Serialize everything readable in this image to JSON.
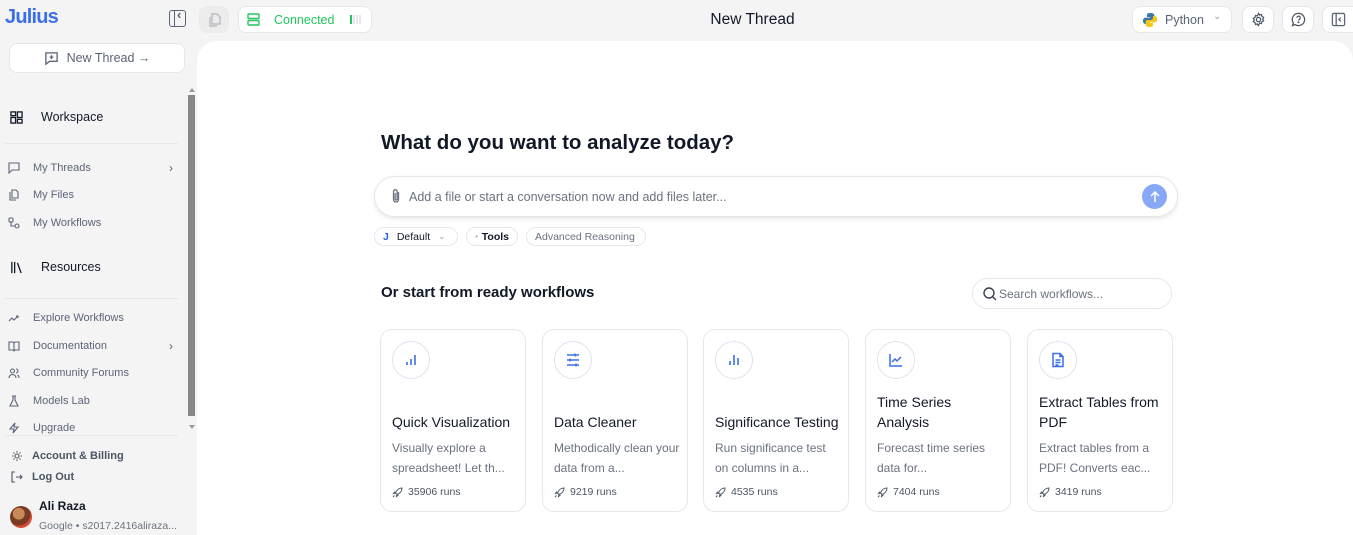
{
  "app": {
    "logo": "Julius",
    "page_title": "New Thread"
  },
  "sidebar": {
    "new_thread_label": "New Thread →",
    "workspace": {
      "heading": "Workspace",
      "items": [
        {
          "label": "My Threads",
          "icon": "chat-bubble-icon",
          "has_chevron": true
        },
        {
          "label": "My Files",
          "icon": "files-icon",
          "has_chevron": false
        },
        {
          "label": "My Workflows",
          "icon": "workflow-icon",
          "has_chevron": false
        }
      ]
    },
    "resources": {
      "heading": "Resources",
      "items": [
        {
          "label": "Explore Workflows",
          "icon": "trending-icon",
          "has_chevron": false
        },
        {
          "label": "Documentation",
          "icon": "book-icon",
          "has_chevron": true
        },
        {
          "label": "Community Forums",
          "icon": "users-icon",
          "has_chevron": false
        },
        {
          "label": "Models Lab",
          "icon": "flask-icon",
          "has_chevron": false
        },
        {
          "label": "Upgrade",
          "icon": "zap-icon",
          "has_chevron": false
        }
      ]
    },
    "account_billing": "Account & Billing",
    "log_out": "Log Out",
    "user": {
      "name": "Ali Raza",
      "sub": "Google • s2017.2416aliraza..."
    }
  },
  "topbar": {
    "connection_status": "Connected",
    "language": "Python",
    "status_color": "#22c55e"
  },
  "main": {
    "headline": "What do you want to analyze today?",
    "prompt_placeholder": "Add a file or start a conversation now and add files later...",
    "chips": {
      "model_letter": "J",
      "model": "Default",
      "tools": "Tools",
      "advanced": "Advanced Reasoning"
    },
    "workflows_heading": "Or start from ready workflows",
    "search_placeholder": "Search workflows...",
    "workflows": [
      {
        "title": "Quick Visualization",
        "desc": "Visually explore a spreadsheet! Let th...",
        "runs": "35906 runs",
        "icon": "bar-chart-icon"
      },
      {
        "title": "Data Cleaner",
        "desc": "Methodically clean your data from a...",
        "runs": "9219 runs",
        "icon": "sliders-icon"
      },
      {
        "title": "Significance Testing",
        "desc": "Run significance test on columns in a...",
        "runs": "4535 runs",
        "icon": "bar-chart-icon"
      },
      {
        "title": "Time Series Analysis",
        "desc": "Forecast time series data for...",
        "runs": "7404 runs",
        "icon": "line-chart-icon"
      },
      {
        "title": "Extract Tables from PDF",
        "desc": "Extract tables from a PDF! Converts eac...",
        "runs": "3419 runs",
        "icon": "document-icon"
      }
    ]
  },
  "colors": {
    "accent": "#3b6fe8",
    "send_button": "#86a8f5",
    "connected": "#22c55e"
  }
}
